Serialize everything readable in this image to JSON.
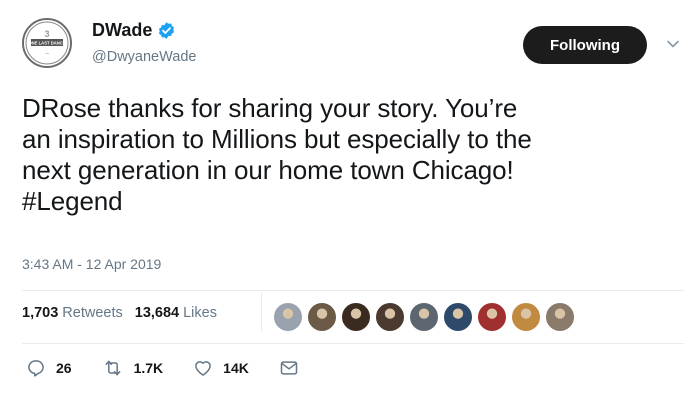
{
  "author": {
    "display_name": "DWade",
    "handle": "@DwyaneWade",
    "avatar_text": "ONE LAST DANCE"
  },
  "follow_button": {
    "label": "Following"
  },
  "tweet": {
    "text": "DRose thanks for sharing your story. You’re\nan inspiration to Millions but especially to the\nnext generation in our home town Chicago!\n#Legend",
    "timestamp": "3:43 AM - 12 Apr 2019"
  },
  "stats": {
    "retweets_count": "1,703",
    "retweets_label": "Retweets",
    "likes_count": "13,684",
    "likes_label": "Likes"
  },
  "liked_by_avatars": [
    {
      "color": "#9aa3ad"
    },
    {
      "color": "#6b5a45"
    },
    {
      "color": "#3b2a20"
    },
    {
      "color": "#4a3a30"
    },
    {
      "color": "#5c6670"
    },
    {
      "color": "#2d4a6a"
    },
    {
      "color": "#a03030"
    },
    {
      "color": "#c08a40"
    },
    {
      "color": "#8a7a6a"
    }
  ],
  "actions": {
    "replies": "26",
    "retweets": "1.7K",
    "likes": "14K"
  },
  "colors": {
    "accent_dark": "#1c1c1c",
    "verified": "#1da1f2",
    "muted": "#657786"
  },
  "icons": [
    "verified-icon",
    "chevron-down-icon",
    "reply-icon",
    "retweet-icon",
    "like-icon",
    "message-icon"
  ]
}
